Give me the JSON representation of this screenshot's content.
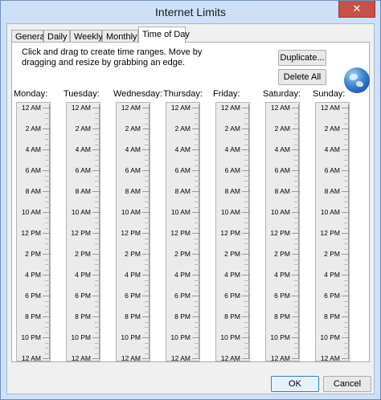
{
  "window": {
    "title": "Internet Limits",
    "close_glyph": "✕"
  },
  "tabs": [
    {
      "label": "General"
    },
    {
      "label": "Daily"
    },
    {
      "label": "Weekly"
    },
    {
      "label": "Monthly"
    },
    {
      "label": "Time of Day",
      "active": true
    }
  ],
  "instructions": "Click and drag to create time ranges. Move by dragging and resize by grabbing an edge.",
  "buttons": {
    "duplicate": "Duplicate...",
    "delete_all": "Delete All",
    "ok": "OK",
    "cancel": "Cancel"
  },
  "icons": {
    "globe": "globe-icon"
  },
  "days": [
    "Monday:",
    "Tuesday:",
    "Wednesday:",
    "Thursday:",
    "Friday:",
    "Saturday:",
    "Sunday:"
  ],
  "time_labels": [
    "12 AM",
    "2 AM",
    "4 AM",
    "6 AM",
    "8 AM",
    "10 AM",
    "12 PM",
    "2 PM",
    "4 PM",
    "6 PM",
    "8 PM",
    "10 PM",
    "12 AM"
  ],
  "colors": {
    "title_bar": "#cde0f7",
    "close_button": "#c7504a",
    "column_bg": "#ebebeb"
  }
}
